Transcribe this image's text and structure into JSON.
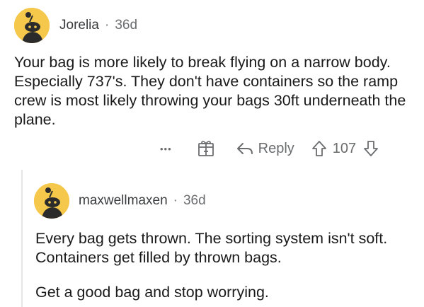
{
  "comments": [
    {
      "author": "Jorelia",
      "age": "36d",
      "paragraphs": [
        "Your bag is more likely to break flying on a narrow body. Especially 737's. They don't have containers so the ramp crew is most likely throwing your bags 30ft underneath the plane."
      ],
      "actions": {
        "more_label": "•••",
        "reply_label": "Reply",
        "score": "107"
      }
    },
    {
      "author": "maxwellmaxen",
      "age": "36d",
      "paragraphs": [
        "Every bag gets thrown. The sorting system isn't soft. Containers get filled by thrown bags.",
        "Get a good bag and stop worrying."
      ]
    }
  ],
  "separator": "·",
  "colors": {
    "avatar": "#f5c84c",
    "text": "#1a1a1b",
    "meta": "#6b6c6e"
  },
  "icons": [
    "snoo-avatar-icon",
    "award-icon",
    "reply-arrow-icon",
    "upvote-icon",
    "downvote-icon"
  ]
}
